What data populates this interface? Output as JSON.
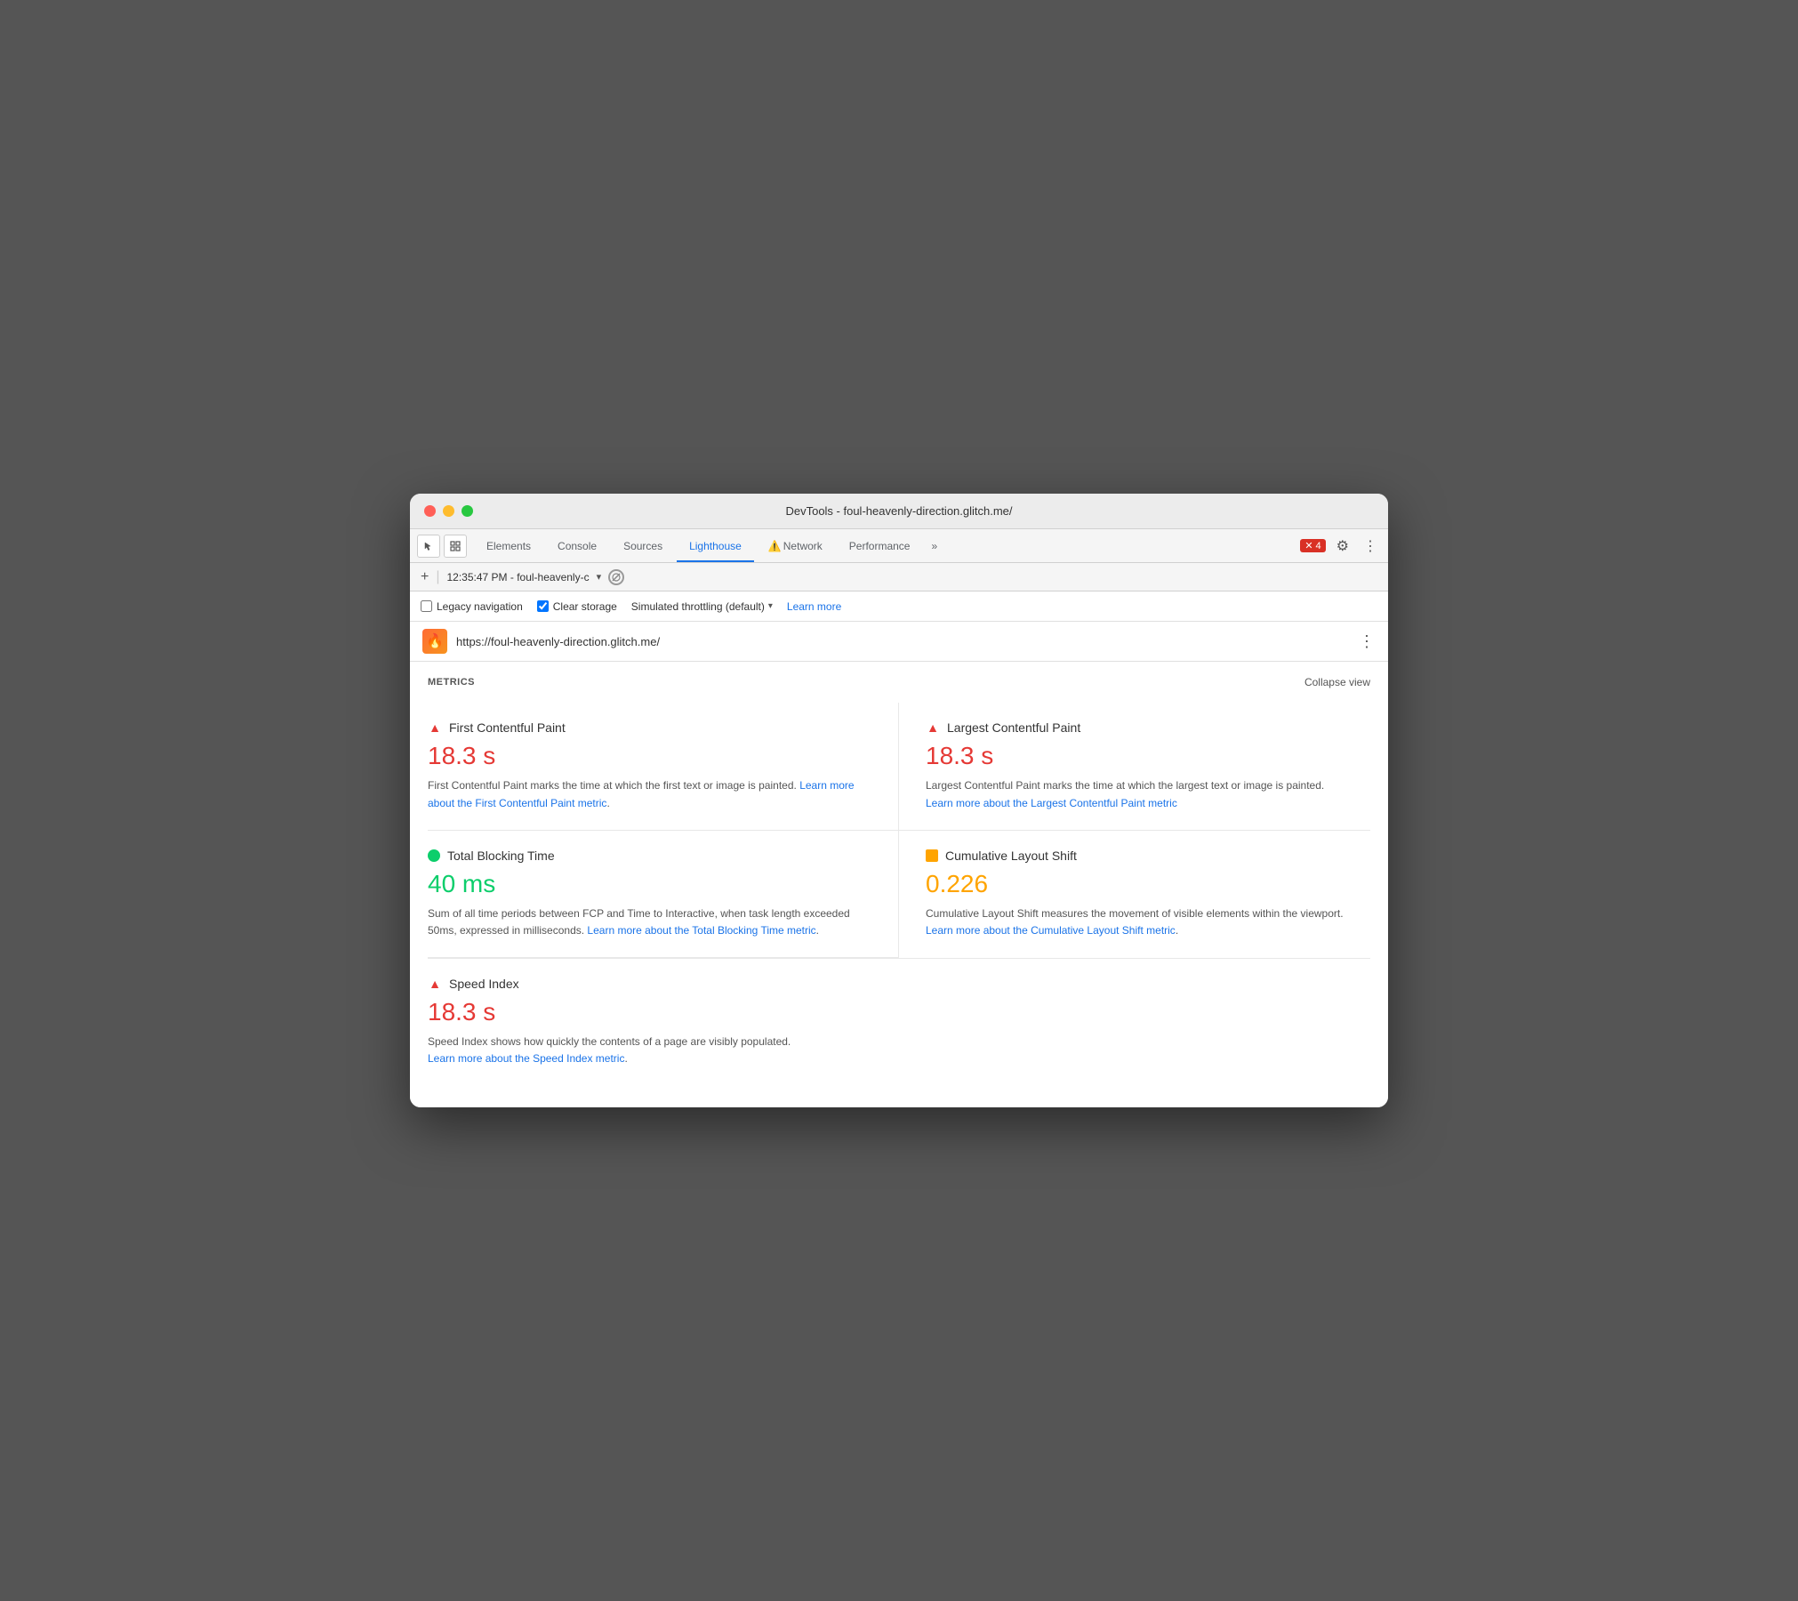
{
  "window": {
    "title": "DevTools - foul-heavenly-direction.glitch.me/"
  },
  "tabs": {
    "items": [
      {
        "id": "elements",
        "label": "Elements",
        "active": false
      },
      {
        "id": "console",
        "label": "Console",
        "active": false
      },
      {
        "id": "sources",
        "label": "Sources",
        "active": false
      },
      {
        "id": "lighthouse",
        "label": "Lighthouse",
        "active": true
      },
      {
        "id": "network",
        "label": "Network",
        "active": false,
        "warning": true
      },
      {
        "id": "performance",
        "label": "Performance",
        "active": false
      }
    ],
    "more_label": "»",
    "error_count": "4"
  },
  "subtoolbar": {
    "time": "12:35:47 PM - foul-heavenly-c",
    "add_label": "+"
  },
  "options": {
    "legacy_nav_label": "Legacy navigation",
    "legacy_nav_checked": false,
    "clear_storage_label": "Clear storage",
    "clear_storage_checked": true,
    "throttle_label": "Simulated throttling (default)",
    "learn_more_label": "Learn more"
  },
  "url_bar": {
    "url": "https://foul-heavenly-direction.glitch.me/",
    "icon": "🔥"
  },
  "metrics": {
    "title": "METRICS",
    "collapse_label": "Collapse view",
    "items": [
      {
        "id": "fcp",
        "status": "red-triangle",
        "name": "First Contentful Paint",
        "value": "18.3 s",
        "value_color": "red",
        "description": "First Contentful Paint marks the time at which the first text or image is painted.",
        "link_text": "Learn more about the First Contentful Paint metric",
        "link_url": "#"
      },
      {
        "id": "lcp",
        "status": "red-triangle",
        "name": "Largest Contentful Paint",
        "value": "18.3 s",
        "value_color": "red",
        "description": "Largest Contentful Paint marks the time at which the largest text or image is painted.",
        "link_text": "Learn more about the Largest Contentful Paint metric",
        "link_url": "#"
      },
      {
        "id": "tbt",
        "status": "green-circle",
        "name": "Total Blocking Time",
        "value": "40 ms",
        "value_color": "green",
        "description": "Sum of all time periods between FCP and Time to Interactive, when task length exceeded 50ms, expressed in milliseconds.",
        "link_text": "Learn more about the Total Blocking Time metric",
        "link_url": "#"
      },
      {
        "id": "cls",
        "status": "orange-square",
        "name": "Cumulative Layout Shift",
        "value": "0.226",
        "value_color": "orange",
        "description": "Cumulative Layout Shift measures the movement of visible elements within the viewport.",
        "link_text": "Learn more about the Cumulative Layout Shift metric",
        "link_url": "#"
      },
      {
        "id": "si",
        "status": "red-triangle",
        "name": "Speed Index",
        "value": "18.3 s",
        "value_color": "red",
        "description": "Speed Index shows how quickly the contents of a page are visibly populated.",
        "link_text": "Learn more about the Speed Index metric",
        "link_url": "#",
        "full_width": true
      }
    ]
  }
}
